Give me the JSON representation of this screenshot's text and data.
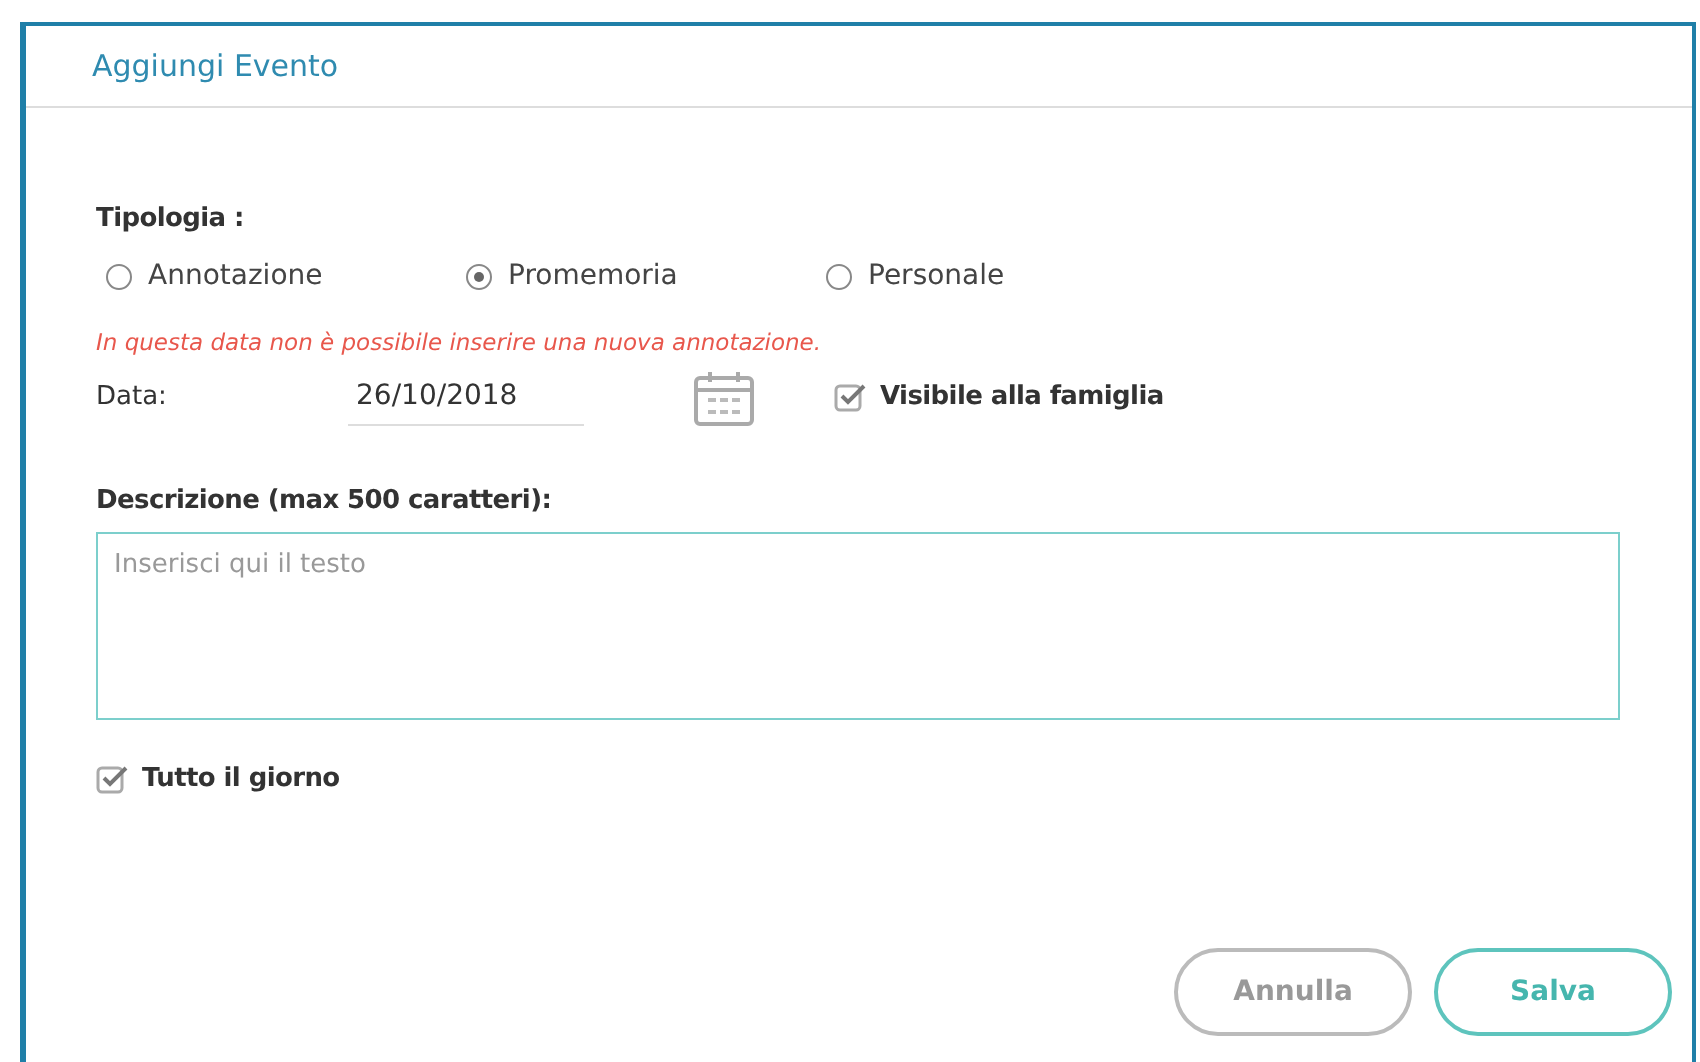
{
  "window": {
    "title": "Aggiungi Evento"
  },
  "tipologia": {
    "label": "Tipologia :",
    "options": [
      {
        "label": "Annotazione",
        "selected": false
      },
      {
        "label": "Promemoria",
        "selected": true
      },
      {
        "label": "Personale",
        "selected": false
      }
    ]
  },
  "error": "In questa data non è possibile inserire una nuova annotazione.",
  "date": {
    "label": "Data:",
    "value": "26/10/2018"
  },
  "visible": {
    "label": "Visibile alla famiglia",
    "checked": true
  },
  "description": {
    "label": "Descrizione (max 500 caratteri):",
    "placeholder": "Inserisci qui il testo"
  },
  "all_day": {
    "label": "Tutto il giorno",
    "checked": true
  },
  "buttons": [
    {
      "label": "Annulla",
      "kind": "secondary"
    },
    {
      "label": "Salva",
      "kind": "primary"
    }
  ]
}
